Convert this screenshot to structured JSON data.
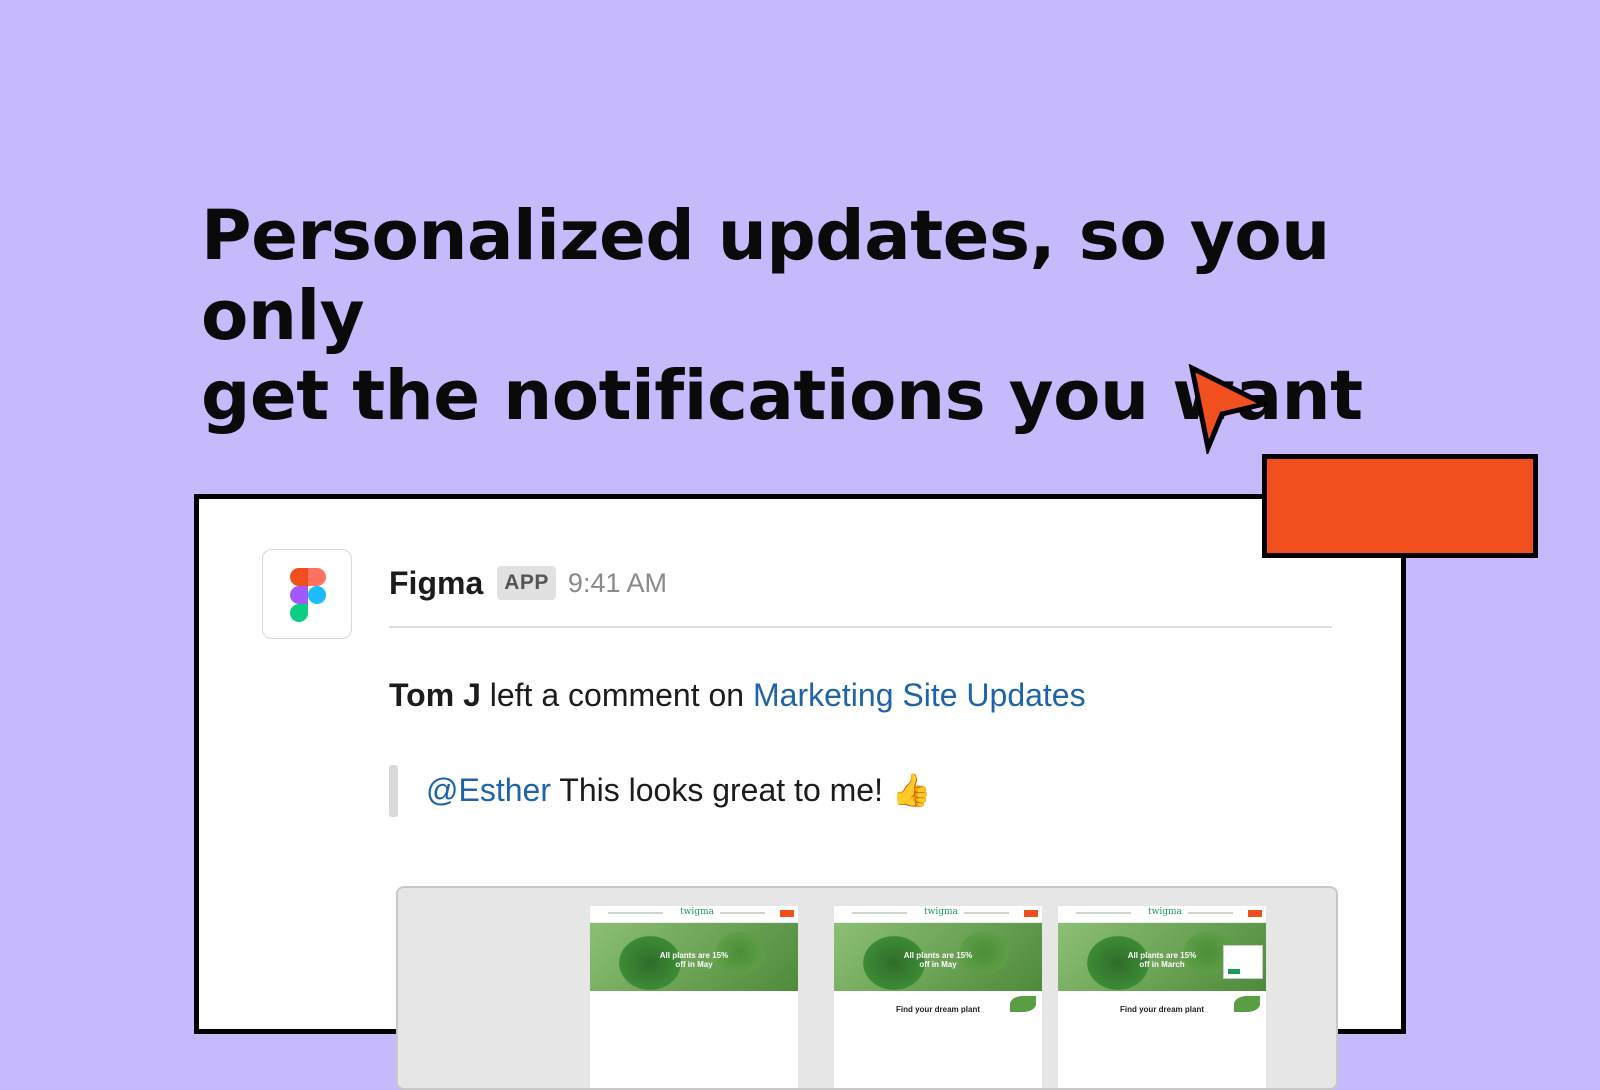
{
  "headline": {
    "line1": "Personalized updates, so you only",
    "line2": "get the notifications you want"
  },
  "colors": {
    "background": "#c6bafd",
    "accent": "#f24f1e",
    "link": "#1f64a8"
  },
  "message": {
    "sender": "Figma",
    "badge": "APP",
    "time": "9:41 AM",
    "comment": {
      "author": "Tom J",
      "action": " left a comment on ",
      "file_link": "Marketing Site Updates"
    },
    "quote": {
      "mention": "@Esther",
      "text": " This looks great to me! ",
      "emoji": "👍"
    }
  },
  "preview": {
    "thumbnails": [
      {
        "brand": "twigma",
        "promo_line1": "All plants are 15%",
        "promo_line2": "off in May",
        "subtitle": ""
      },
      {
        "brand": "twigma",
        "promo_line1": "All plants are 15%",
        "promo_line2": "off in May",
        "subtitle": "Find your dream plant"
      },
      {
        "brand": "twigma",
        "promo_line1": "All plants are 15%",
        "promo_line2": "off in March",
        "subtitle": "Find your dream plant"
      }
    ]
  }
}
